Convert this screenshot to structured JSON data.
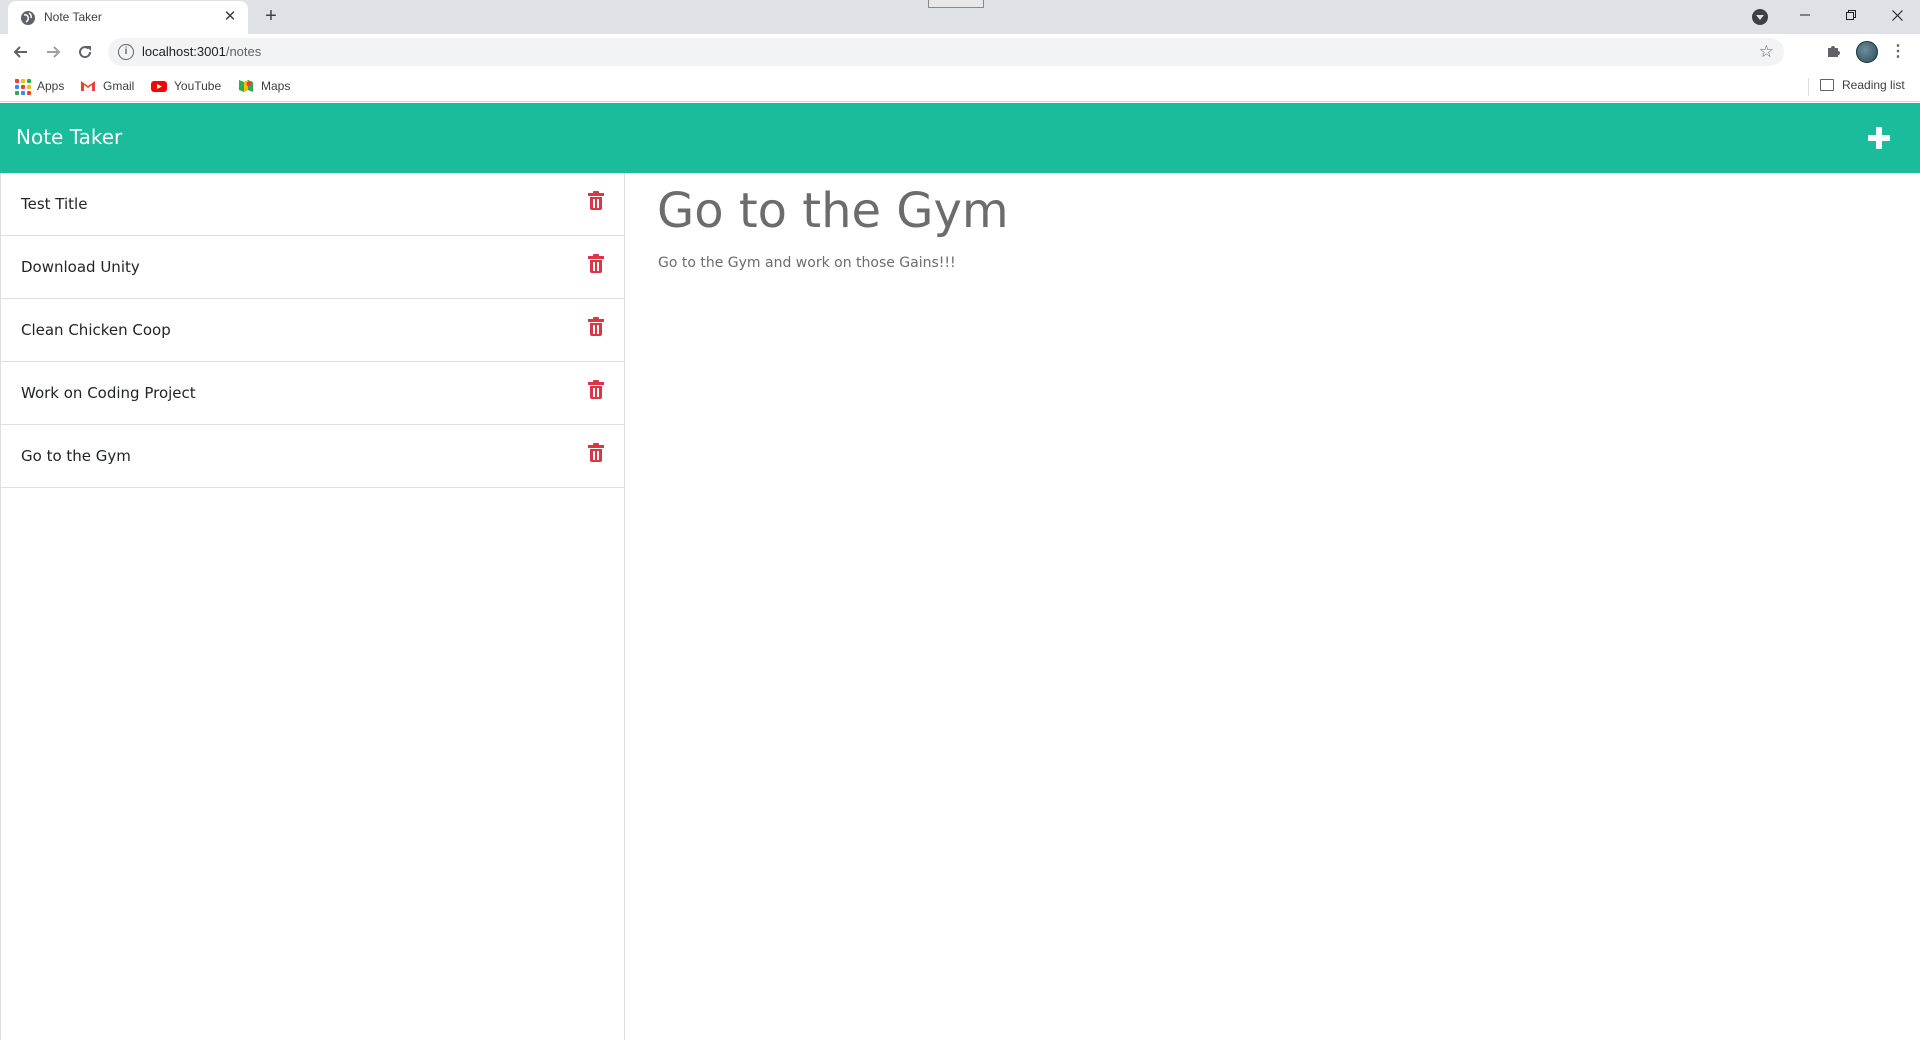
{
  "browser": {
    "tab_title": "Note Taker",
    "tab_close": "✕",
    "new_tab": "+",
    "url_host": "localhost:3001",
    "url_path": "/notes",
    "bookmarks": [
      "Apps",
      "Gmail",
      "YouTube",
      "Maps"
    ],
    "reading_list": "Reading list"
  },
  "app": {
    "brand": "Note Taker",
    "accent_color": "#1abc9c",
    "delete_color": "#dc3545",
    "notes": [
      {
        "title": "Test Title"
      },
      {
        "title": "Download Unity"
      },
      {
        "title": "Clean Chicken Coop"
      },
      {
        "title": "Work on Coding Project"
      },
      {
        "title": "Go to the Gym"
      }
    ],
    "active_note": {
      "title": "Go to the Gym",
      "text": "Go to the Gym and work on those Gains!!!"
    }
  }
}
